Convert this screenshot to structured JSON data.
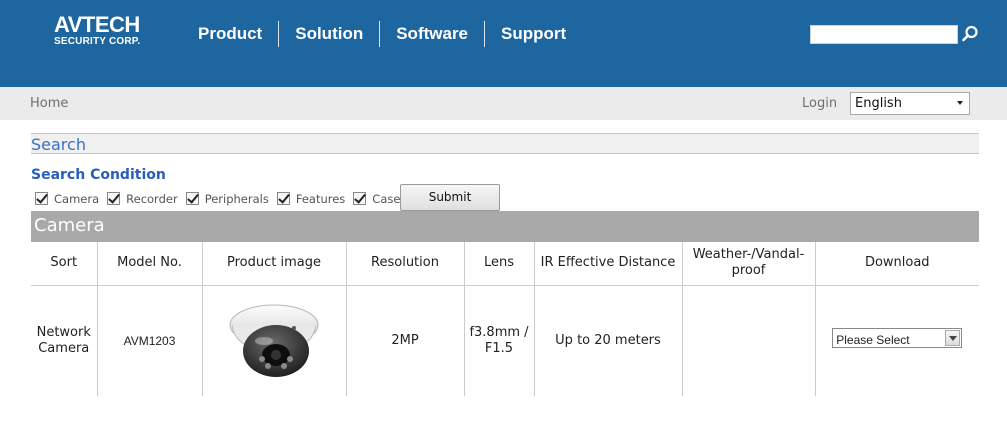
{
  "header": {
    "logo_main": "AVTECH",
    "logo_sub": "SECURITY CORP.",
    "nav": [
      "Product",
      "Solution",
      "Software",
      "Support"
    ],
    "search_value": ""
  },
  "subbar": {
    "home": "Home",
    "login": "Login",
    "language": "English"
  },
  "search": {
    "title": "Search",
    "condition_title": "Search Condition",
    "checkboxes": [
      "Camera",
      "Recorder",
      "Peripherals",
      "Features",
      "Case"
    ],
    "submit": "Submit"
  },
  "category": "Camera",
  "table": {
    "columns": [
      "Sort",
      "Model No.",
      "Product image",
      "Resolution",
      "Lens",
      "IR Effective Distance",
      "Weather-/Vandal-proof",
      "Download"
    ],
    "rows": [
      {
        "sort": "Network Camera",
        "model": "AVM1203",
        "resolution": "2MP",
        "lens": "f3.8mm / F1.5",
        "ir": "Up to 20 meters",
        "weather": "",
        "download": "Please Select"
      }
    ]
  }
}
